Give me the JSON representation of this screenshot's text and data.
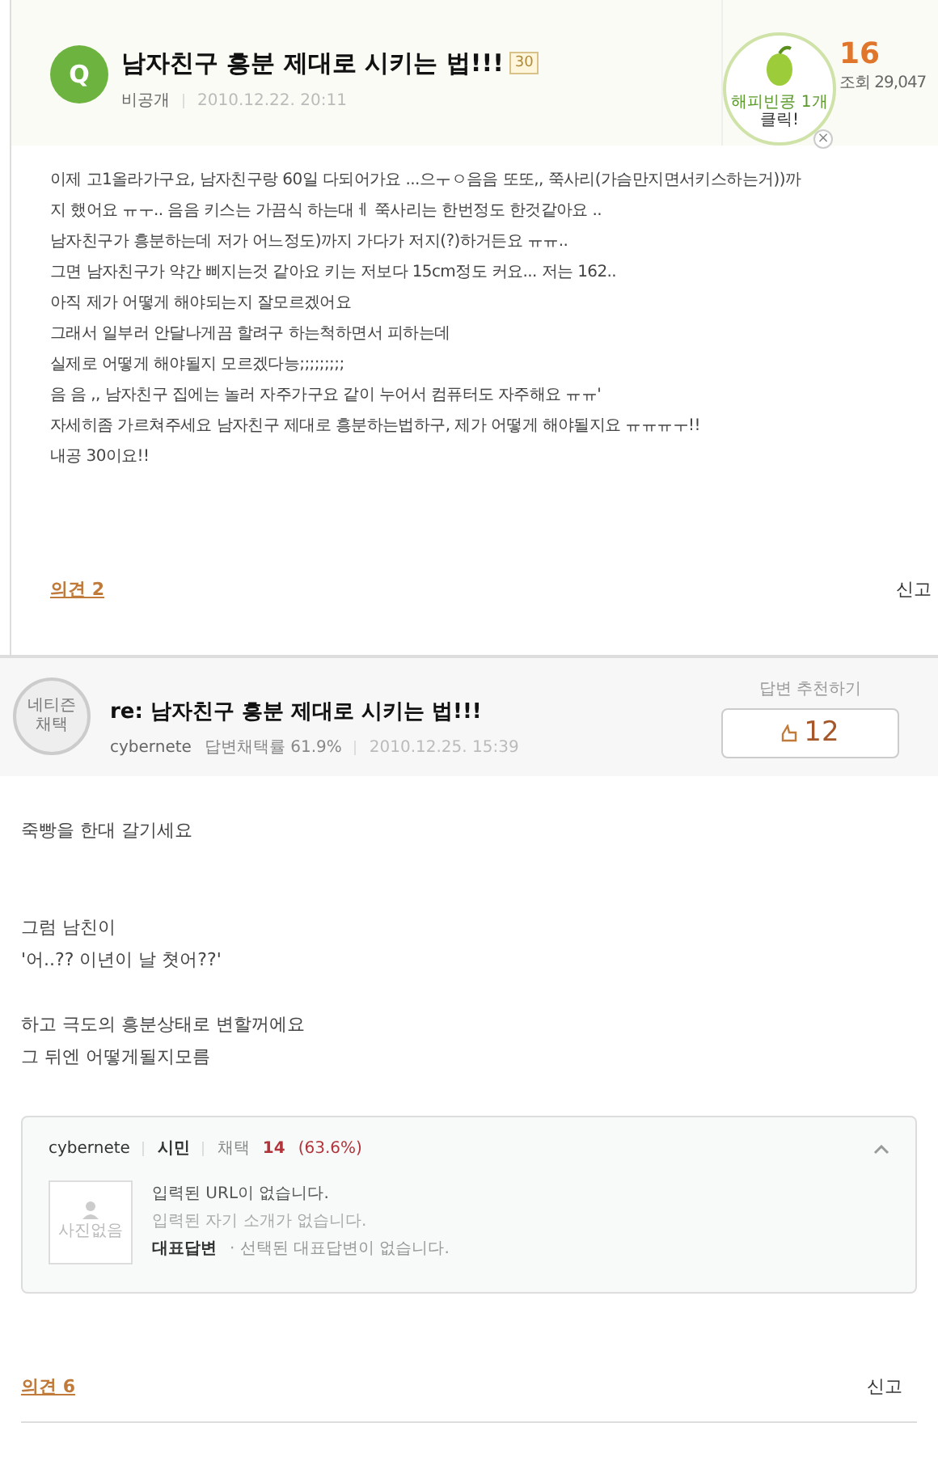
{
  "question": {
    "avatar_letter": "Q",
    "title": "남자친구 흥분 제대로 시키는 법!!!",
    "points": "30",
    "author": "비공개",
    "date": "2010.12.22. 20:11",
    "happybean": {
      "line1": "해피빈콩 1개",
      "line2": "클릭!",
      "close": "×"
    },
    "answer_count": "16",
    "views": "조회 29,047",
    "body": [
      "이제 고1올라가구요, 남자친구랑 60일 다되어가요 ...으ㅜㅇ음음 또또,, 쭉사리(가슴만지면서키스하는거))까",
      "지 했어요 ㅠㅜ.. 음음 키스는 가끔식 하는대ㅔ 쭉사리는 한번정도 한것같아요 ..",
      "남자친구가 흥분하는데 저가 어느정도)까지 가다가 저지(?)하거든요 ㅠㅠ..",
      "그면 남자친구가 약간 삐지는것 같아요 키는 저보다 15cm정도 커요... 저는 162..",
      "아직 제가 어떻게 해야되는지 잘모르겠어요",
      "그래서 일부러 안달나게끔 할려구 하는척하면서 피하는데",
      "실제로 어떻게 해야될지 모르겠다능;;;;;;;;;",
      "음 음 ,, 남자친구 집에는 놀러 자주가구요 같이 누어서 컴퓨터도 자주해요 ㅠㅠ'",
      "자세히좀 가르쳐주세요 남자친구 제대로 흥분하는법하구, 제가 어떻게 해야될지요 ㅠㅠㅠㅜ!!",
      "내공 30이요!!"
    ],
    "comments": "의견 2",
    "report": "신고"
  },
  "answer": {
    "medal_line1": "네티즌",
    "medal_line2": "채택",
    "title": "re: 남자친구 흥분 제대로 시키는 법!!!",
    "author": "cybernete",
    "rate": "답변채택률 61.9%",
    "date": "2010.12.25. 15:39",
    "recommend_label": "답변 추천하기",
    "recommend_count": "12",
    "body": [
      [
        "죽빵을 한대 갈기세요"
      ],
      [
        "그럼 남친이",
        "'어..?? 이년이 날 쳣어??'"
      ],
      [
        "하고 극도의 흥분상태로 변할꺼에요",
        "그 뒤엔 어떻게될지모름"
      ]
    ],
    "profile": {
      "name": "cybernete",
      "rank": "시민",
      "adopt_label": "채택",
      "adopt_count": "14",
      "adopt_rate": "(63.6%)",
      "expanded": true,
      "photo": "사진없음",
      "url": "입력된 URL이 없습니다.",
      "intro": "입력된 자기 소개가 없습니다.",
      "rep_label": "대표답변",
      "rep_text": "· 선택된 대표답변이 없습니다."
    },
    "comments": "의견 6",
    "report": "신고"
  }
}
